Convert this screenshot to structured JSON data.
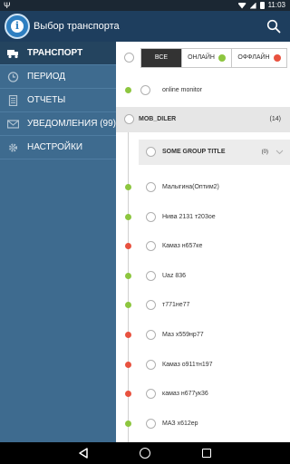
{
  "status_bar": {
    "left_icon": "usb-icon",
    "time": "11:03"
  },
  "action_bar": {
    "title": "Выбор транспорта",
    "logo_letter": "i",
    "search_icon": "search-icon"
  },
  "sidebar": {
    "items": [
      {
        "label": "ТРАНСПОРТ",
        "icon": "truck-icon",
        "active": true
      },
      {
        "label": "ПЕРИОД",
        "icon": "clock-icon",
        "active": false
      },
      {
        "label": "ОТЧЕТЫ",
        "icon": "document-icon",
        "active": false
      },
      {
        "label": "УВЕДОМЛЕНИЯ (99)",
        "icon": "envelope-icon",
        "active": false
      },
      {
        "label": "НАСТРОЙКИ",
        "icon": "gear-icon",
        "active": false
      }
    ]
  },
  "filter": {
    "all_label": "ВСЕ",
    "online_label": "ОНЛАЙН",
    "offline_label": "ОФФЛАЙН",
    "selected": "ВСЕ"
  },
  "colors": {
    "online": "#8dc63f",
    "offline": "#e8523f",
    "accent": "#1e3e5e"
  },
  "online_monitor": {
    "label": "online monitor",
    "status": "online"
  },
  "group": {
    "name": "MOB_DILER",
    "count": "(14)"
  },
  "subgroup": {
    "name": "SOME GROUP TITLE",
    "count": "(0)"
  },
  "vehicles": [
    {
      "label": "Малыгина(Оптим2)",
      "status": "online"
    },
    {
      "label": "Нива 2131 т203ое",
      "status": "online"
    },
    {
      "label": "Камаз н657ке",
      "status": "offline"
    },
    {
      "label": "Uaz 836",
      "status": "online"
    },
    {
      "label": "т771не77",
      "status": "online"
    },
    {
      "label": "Маз х559нр77",
      "status": "offline"
    },
    {
      "label": "Камаз о911тн197",
      "status": "offline"
    },
    {
      "label": "камаз н677ук36",
      "status": "offline"
    },
    {
      "label": "МАЗ х612ер",
      "status": "online"
    }
  ]
}
